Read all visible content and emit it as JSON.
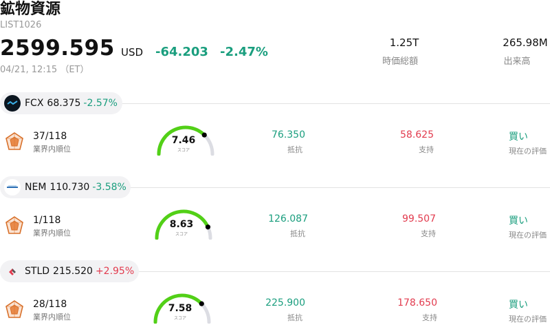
{
  "header": {
    "title": "鉱物資源",
    "code": "LIST1026",
    "price": "2599.595",
    "currency": "USD",
    "change": "-64.203",
    "change_pct": "-2.47%",
    "time": "04/21, 12:15 （ET）",
    "market_cap_value": "1.25T",
    "market_cap_label": "時価総額",
    "volume_value": "265.98M",
    "volume_label": "出来高"
  },
  "rows": [
    {
      "ticker": "FCX",
      "price": "68.375",
      "change_pct": "-2.57%",
      "trend": "neg",
      "rank": "37/118",
      "rank_label": "業界内順位",
      "score": "7.46",
      "score_value": 7.46,
      "score_label": "スコア",
      "resistance": "76.350",
      "resistance_label": "抵抗",
      "support": "58.625",
      "support_label": "支持",
      "rating": "買い",
      "rating_label": "現在の評価"
    },
    {
      "ticker": "NEM",
      "price": "110.730",
      "change_pct": "-3.58%",
      "trend": "neg",
      "rank": "1/118",
      "rank_label": "業界内順位",
      "score": "8.63",
      "score_value": 8.63,
      "score_label": "スコア",
      "resistance": "126.087",
      "resistance_label": "抵抗",
      "support": "99.507",
      "support_label": "支持",
      "rating": "買い",
      "rating_label": "現在の評価"
    },
    {
      "ticker": "STLD",
      "price": "215.520",
      "change_pct": "+2.95%",
      "trend": "pos",
      "rank": "28/118",
      "rank_label": "業界内順位",
      "score": "7.58",
      "score_value": 7.58,
      "score_label": "スコア",
      "resistance": "225.900",
      "resistance_label": "抵抗",
      "support": "178.650",
      "support_label": "支持",
      "rating": "買い",
      "rating_label": "現在の評価"
    }
  ],
  "colors": {
    "up": "#e23b4e",
    "down": "#1a9e7e",
    "gauge_fill": "#52d017",
    "gauge_track": "#dcdde3"
  }
}
